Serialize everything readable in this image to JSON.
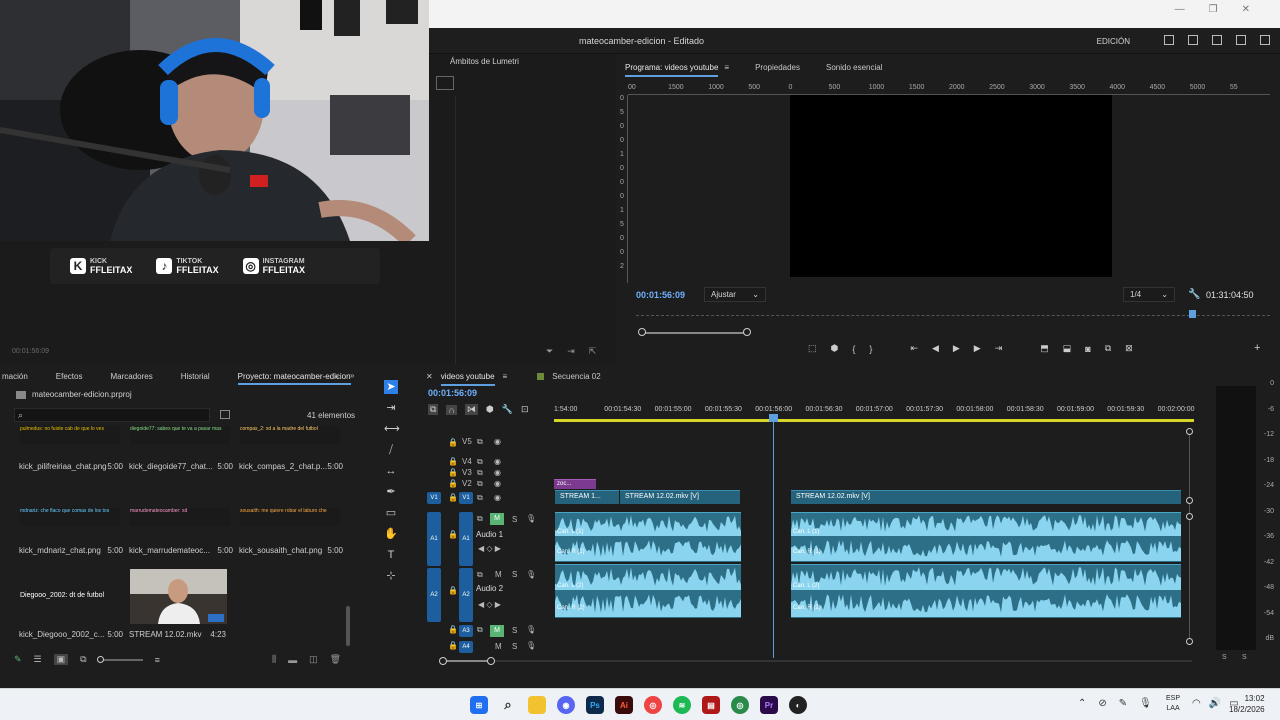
{
  "app": {
    "title": "mateocamber-edicion - Editado",
    "workspace": "EDICIÓN"
  },
  "social": [
    {
      "network": "KICK",
      "handle": "FFLEITAX"
    },
    {
      "network": "TIKTOK",
      "handle": "FFLEITAX"
    },
    {
      "network": "INSTAGRAM",
      "handle": "FFLEITAX"
    }
  ],
  "lumetri": {
    "tab": "Ámbitos de Lumetri",
    "timecode": "00:01:56:09"
  },
  "program": {
    "tabs": [
      "Programa: videos youtube",
      "Propiedades",
      "Sonido esencial"
    ],
    "ruler": [
      "00",
      "1500",
      "1000",
      "500",
      "0",
      "500",
      "1000",
      "1500",
      "2000",
      "2500",
      "3000",
      "3500",
      "4000",
      "4500",
      "5000",
      "55"
    ],
    "vruler": [
      "0",
      "5",
      "0",
      "0",
      "1",
      "0",
      "0",
      "0",
      "1",
      "5",
      "0",
      "0",
      "2"
    ],
    "timecode": "00:01:56:09",
    "fit": "Ajustar",
    "resolution": "1/4",
    "duration": "01:31:04:50"
  },
  "project": {
    "tabs": [
      "mación",
      "Efectos",
      "Marcadores",
      "Historial",
      "Proyecto: mateocamber-edicion"
    ],
    "file": "mateocamber-edicion.prproj",
    "count": "41 elementos",
    "items": [
      [
        {
          "thumb": "pulmedus: no fuiste cab de que lo ves",
          "name": "kick_pilifreiriaa_chat.png",
          "dur": "5:00"
        },
        {
          "thumb": "diegoide77: sabes que te va a pasar mas",
          "name": "kick_diegoide77_chat...",
          "dur": "5:00"
        },
        {
          "thumb": "compas_2: xd a la madre del futbol",
          "name": "kick_compas_2_chat.p...",
          "dur": "5:00"
        }
      ],
      [
        {
          "thumb": "mdnariz: che flaco que comas de los tos",
          "name": "kick_mdnariz_chat.png",
          "dur": "5:00"
        },
        {
          "thumb": "marrudemateocamber: xd",
          "name": "kick_marrudemateoc...",
          "dur": "5:00"
        },
        {
          "thumb": "sousaith: me quiere robar el laburo che",
          "name": "kick_sousaith_chat.png",
          "dur": "5:00"
        }
      ],
      [
        {
          "thumb": "Diegooo_2002: dt de futbol",
          "name": "kick_Diegooo_2002_c...",
          "dur": "5:00"
        },
        {
          "thumb": "",
          "name": "STREAM 12.02.mkv",
          "dur": "4:23"
        }
      ]
    ]
  },
  "timeline": {
    "tabs": [
      "videos youtube",
      "Secuencia 02"
    ],
    "timecode": "00:01:56:09",
    "ruler": [
      "1:54:00",
      "00:01:54:30",
      "00:01:55:00",
      "00:01:55:30",
      "00:01:56:00",
      "00:01:56:30",
      "00:01:57:00",
      "00:01:57:30",
      "00:01:58:00",
      "00:01:58:30",
      "00:01:59:00",
      "00:01:59:30",
      "00:02:00:00"
    ],
    "tracks": {
      "v5": "V5",
      "v4": "V4",
      "v3": "V3",
      "v2": "V2",
      "v1": "V1",
      "a1": "A1",
      "a2": "A2",
      "a3": "A3",
      "a4": "A4",
      "audio1": "Audio 1",
      "audio2": "Audio 2"
    },
    "clips": {
      "v2": "zoc...",
      "v1a": "STREAM 1...",
      "v1b": "STREAM 12.02.mkv [V]",
      "v1c": "STREAM 12.02.mkv [V]",
      "chL1": "Can. L (1)",
      "chR1": "Can. R (1)",
      "chL2": "Can. L (2)",
      "chR2": "Can. R (2)"
    }
  },
  "meter": {
    "scale": [
      "0",
      "-6",
      "-12",
      "-18",
      "-24",
      "-30",
      "-36",
      "-42",
      "-48",
      "-54",
      "dB"
    ],
    "bottom": [
      "S",
      "S"
    ]
  },
  "taskbar": {
    "lang": "ESP",
    "region": "LAA",
    "time": "13:02",
    "date": "18/2/2026"
  }
}
